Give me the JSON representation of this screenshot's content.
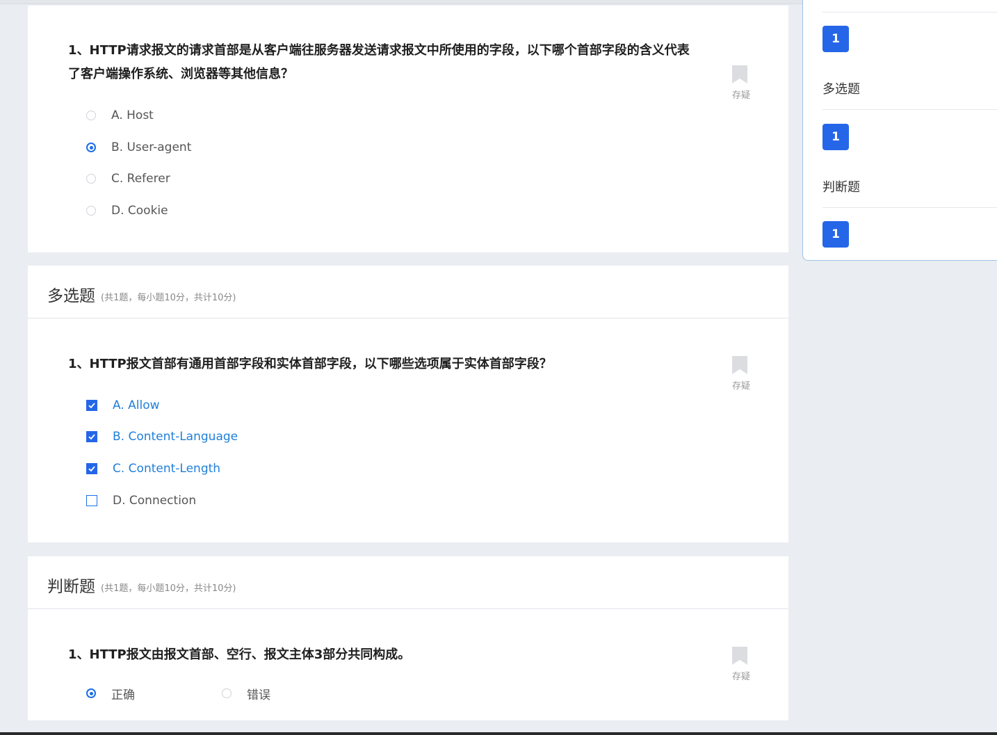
{
  "single": {
    "question": "1、HTTP请求报文的请求首部是从客户端往服务器发送请求报文中所使用的字段，以下哪个首部字段的含义代表了客户端操作系统、浏览器等其他信息？",
    "bookmark_label": "存疑",
    "options": [
      "A. Host",
      "B. User-agent",
      "C. Referer",
      "D. Cookie"
    ],
    "selected_index": 1
  },
  "multi": {
    "title": "多选题",
    "subtitle": "(共1题，每小题10分，共计10分)",
    "question": "1、HTTP报文首部有通用首部字段和实体首部字段，以下哪些选项属于实体首部字段？",
    "bookmark_label": "存疑",
    "options": [
      "A. Allow",
      "B. Content-Language",
      "C. Content-Length",
      "D. Connection"
    ],
    "checked": [
      true,
      true,
      true,
      false
    ]
  },
  "judge": {
    "title": "判断题",
    "subtitle": "(共1题，每小题10分，共计10分)",
    "question": "1、HTTP报文由报文首部、空行、报文主体3部分共同构成。",
    "bookmark_label": "存疑",
    "options": [
      "正确",
      "错误"
    ],
    "selected_index": 0
  },
  "answer_card": {
    "groups": [
      {
        "title": "",
        "numbers": [
          "1"
        ]
      },
      {
        "title": "多选题",
        "numbers": [
          "1"
        ]
      },
      {
        "title": "判断题",
        "numbers": [
          "1"
        ]
      }
    ]
  },
  "colors": {
    "accent": "#2566e8",
    "selected_text": "#1f7fd9",
    "background": "#eaedf2"
  }
}
